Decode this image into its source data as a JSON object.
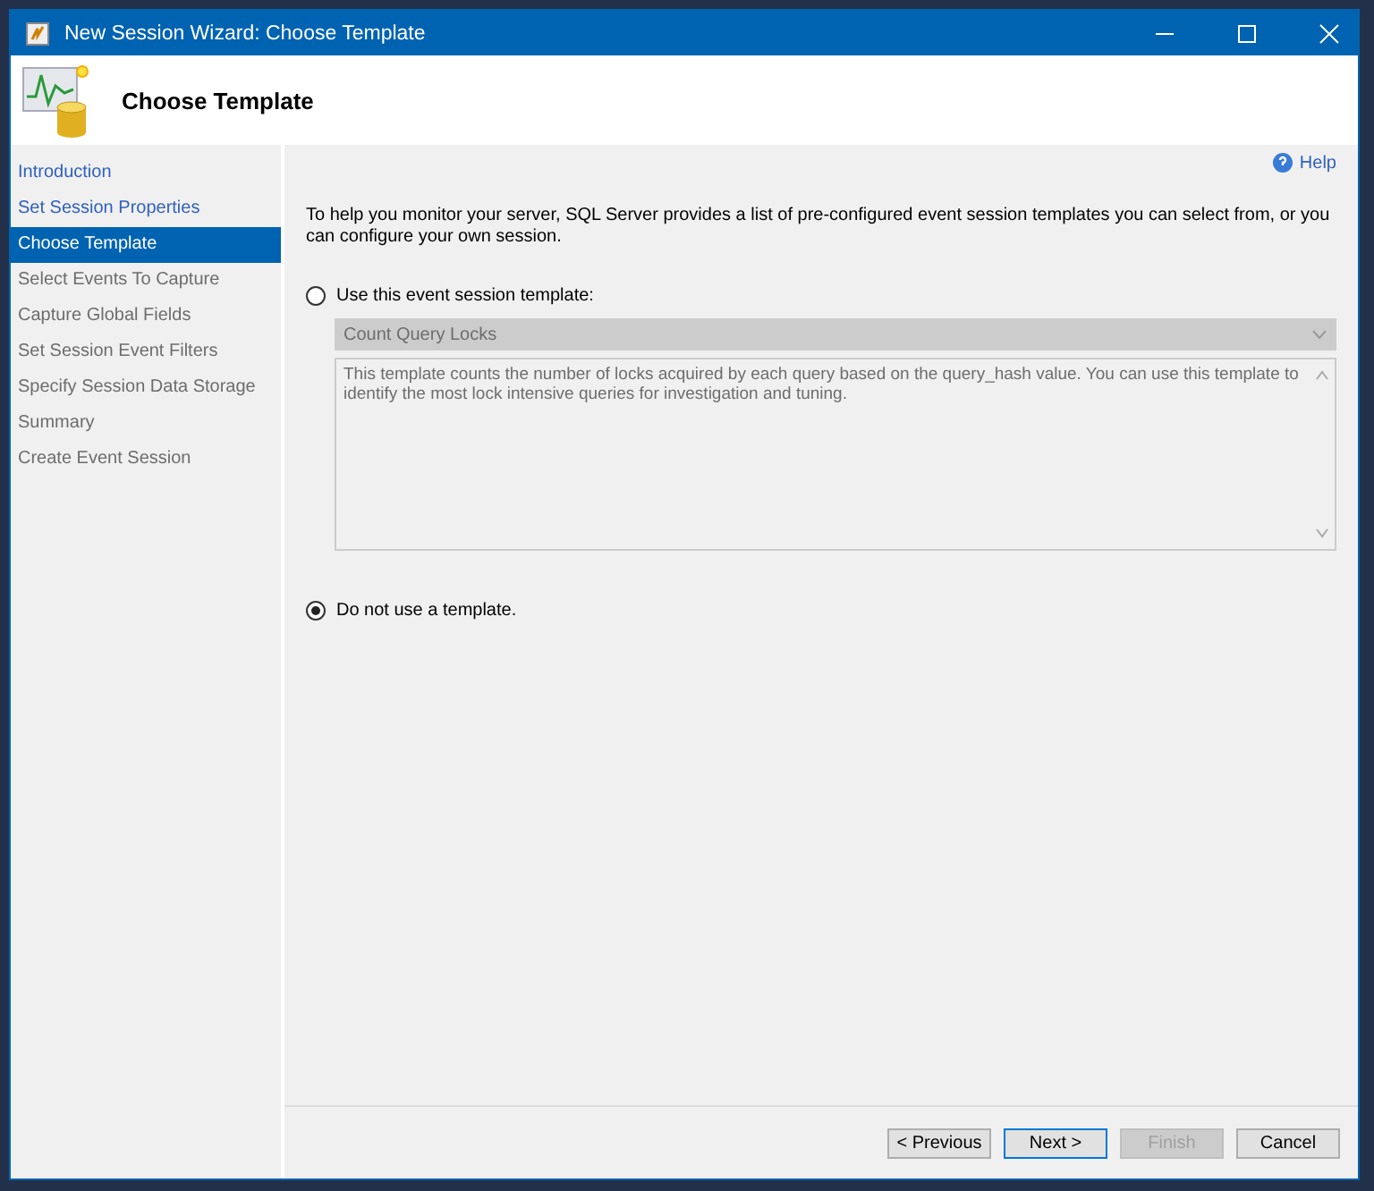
{
  "window": {
    "title": "New Session Wizard: Choose Template"
  },
  "header": {
    "title": "Choose Template"
  },
  "sidebar": {
    "items": [
      {
        "label": "Introduction",
        "selected": false,
        "disabled": false
      },
      {
        "label": "Set Session Properties",
        "selected": false,
        "disabled": false
      },
      {
        "label": "Choose Template",
        "selected": true,
        "disabled": false
      },
      {
        "label": "Select Events To Capture",
        "selected": false,
        "disabled": true
      },
      {
        "label": "Capture Global Fields",
        "selected": false,
        "disabled": true
      },
      {
        "label": "Set Session Event Filters",
        "selected": false,
        "disabled": true
      },
      {
        "label": "Specify Session Data Storage",
        "selected": false,
        "disabled": true
      },
      {
        "label": "Summary",
        "selected": false,
        "disabled": true
      },
      {
        "label": "Create Event Session",
        "selected": false,
        "disabled": true
      }
    ]
  },
  "help": {
    "label": "Help"
  },
  "intro": "To help you monitor your server, SQL Server provides a list of pre-configured event session templates you can select from, or you can configure your own session.",
  "options": [
    {
      "label": "Use this event session template:",
      "selected": false
    },
    {
      "label": "Do not use a template.",
      "selected": true
    }
  ],
  "template": {
    "value": "Count Query Locks",
    "disabled": true,
    "description": "This template counts the number of locks acquired by each query based on the query_hash value. You can use this template to identify the most lock intensive queries for investigation and tuning."
  },
  "buttons": [
    {
      "label": "< Previous",
      "disabled": false,
      "default": false
    },
    {
      "label": "Next >",
      "disabled": false,
      "default": true
    },
    {
      "label": "Finish",
      "disabled": true,
      "default": false
    },
    {
      "label": "Cancel",
      "disabled": false,
      "default": false
    }
  ]
}
